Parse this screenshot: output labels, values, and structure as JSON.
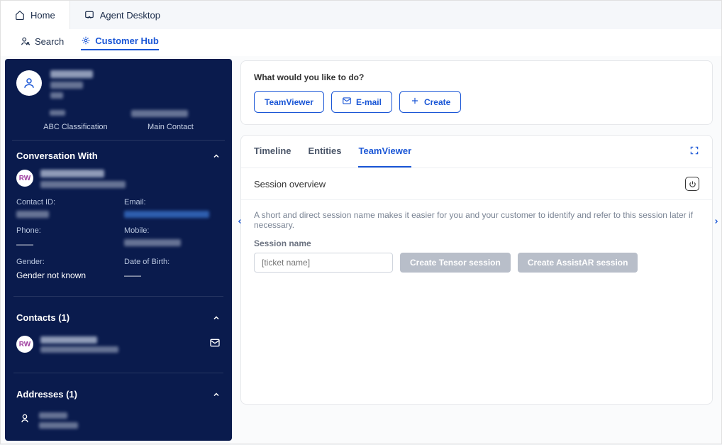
{
  "topTabs": {
    "home": "Home",
    "agentDesktop": "Agent Desktop"
  },
  "subNav": {
    "search": "Search",
    "customerHub": "Customer Hub"
  },
  "leftPanel": {
    "classification": {
      "abc": "ABC Classification",
      "mainContact": "Main Contact"
    },
    "conversationWith": "Conversation With",
    "rwBadge": "RW",
    "fields": {
      "contactId": "Contact ID:",
      "email": "Email:",
      "phone": "Phone:",
      "mobile": "Mobile:",
      "gender": "Gender:",
      "dob": "Date of Birth:",
      "genderValue": "Gender not known"
    },
    "contactsTitle": "Contacts (1)",
    "addressesTitle": "Addresses (1)"
  },
  "rightPanel": {
    "whatLabel": "What would you like to do?",
    "actions": {
      "teamviewer": "TeamViewer",
      "email": "E-mail",
      "create": "Create"
    },
    "innerTabs": {
      "timeline": "Timeline",
      "entities": "Entities",
      "teamviewer": "TeamViewer"
    },
    "overview": "Session overview",
    "hint": "A short and direct session name makes it easier for you and your customer to identify and refer to this session later if necessary.",
    "sessionNameLabel": "Session name",
    "sessionNamePlaceholder": "[ticket name]",
    "createTensor": "Create Tensor session",
    "createAssistAR": "Create AssistAR session"
  }
}
